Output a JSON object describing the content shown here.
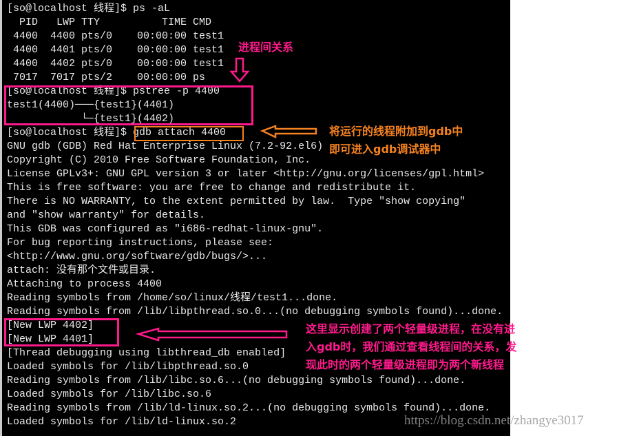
{
  "terminal": {
    "lines": [
      "[so@localhost 线程]$ ps -aL",
      "  PID   LWP TTY          TIME CMD",
      " 4400  4400 pts/0    00:00:00 test1",
      " 4400  4401 pts/0    00:00:00 test1",
      " 4400  4402 pts/0    00:00:00 test1",
      " 7017  7017 pts/2    00:00:00 ps",
      "[so@localhost 线程]$ pstree -p 4400",
      "test1(4400)───{test1}(4401)",
      "            └─{test1}(4402)",
      "[so@localhost 线程]$ gdb attach 4400",
      "GNU gdb (GDB) Red Hat Enterprise Linux (7.2-92.el6)",
      "Copyright (C) 2010 Free Software Foundation, Inc.",
      "License GPLv3+: GNU GPL version 3 or later <http://gnu.org/licenses/gpl.html>",
      "This is free software: you are free to change and redistribute it.",
      "There is NO WARRANTY, to the extent permitted by law.  Type \"show copying\"",
      "and \"show warranty\" for details.",
      "This GDB was configured as \"i686-redhat-linux-gnu\".",
      "For bug reporting instructions, please see:",
      "<http://www.gnu.org/software/gdb/bugs/>...",
      "attach: 没有那个文件或目录.",
      "Attaching to process 4400",
      "Reading symbols from /home/so/linux/线程/test1...done.",
      "Reading symbols from /lib/libpthread.so.0...(no debugging symbols found)...done.",
      "[New LWP 4402]",
      "[New LWP 4401]",
      "[Thread debugging using libthread_db enabled]",
      "Loaded symbols for /lib/libpthread.so.0",
      "Reading symbols from /lib/libc.so.6...(no debugging symbols found)...done.",
      "Loaded symbols for /lib/libc.so.6",
      "Reading symbols from /lib/ld-linux.so.2...(no debugging symbols found)...done.",
      "Loaded symbols for /lib/ld-linux.so.2"
    ]
  },
  "annotations": {
    "process_relation": "进程间关系",
    "attach_note": "将运行的线程附加到gdb中\n即可进入gdb调试器中",
    "lwp_note": "这里显示创建了两个轻量级进程，在没有进\n入gdb时，我们通过查看线程间的关系，发\n现此时的两个轻量级进程即为两个新线程"
  },
  "watermark": "https://blog.csdn.net/zhangye3017",
  "colors": {
    "pink": "#ff1a8c",
    "orange": "#f58220",
    "terminal_bg": "#000000",
    "terminal_fg": "#e8e8e8"
  }
}
